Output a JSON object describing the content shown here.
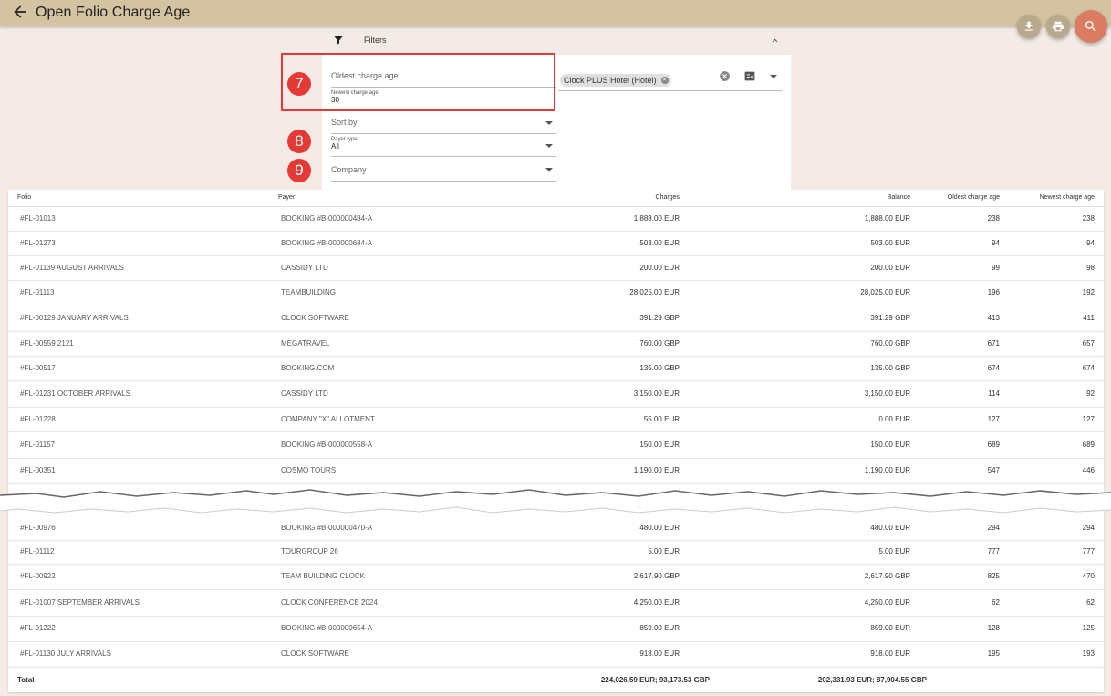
{
  "header": {
    "title": "Open Folio Charge Age"
  },
  "filters": {
    "label": "Filters",
    "oldest_charge_age": {
      "label": "Oldest charge age",
      "value": ""
    },
    "newest_charge_age": {
      "label": "Newest charge age",
      "value": "30"
    },
    "sort_by": {
      "label": "Sort by",
      "value": ""
    },
    "payer_type": {
      "label": "Payer type",
      "value": "All"
    },
    "company": {
      "label": "Company",
      "value": ""
    },
    "property_chip": "Clock PLUS Hotel (Hotel)"
  },
  "badges": [
    "7",
    "8",
    "9"
  ],
  "table": {
    "columns": [
      "Folio",
      "Payer",
      "Charges",
      "Balance",
      "Oldest charge age",
      "Newest charge age"
    ],
    "rows_top": [
      {
        "folio": "#FL-01013",
        "payer": "BOOKING #B-000000484-A",
        "charges": "1,888.00 EUR",
        "balance": "1,888.00 EUR",
        "oldest": "238",
        "newest": "238"
      },
      {
        "folio": "#FL-01273",
        "payer": "BOOKING #B-000000684-A",
        "charges": "503.00 EUR",
        "balance": "503.00 EUR",
        "oldest": "94",
        "newest": "94"
      },
      {
        "folio": "#FL-01139 AUGUST ARRIVALS",
        "payer": "CASSIDY LTD",
        "charges": "200.00 EUR",
        "balance": "200.00 EUR",
        "oldest": "99",
        "newest": "98"
      },
      {
        "folio": "#FL-01113",
        "payer": "TEAMBUILDING",
        "charges": "28,025.00 EUR",
        "balance": "28,025.00 EUR",
        "oldest": "196",
        "newest": "192"
      },
      {
        "folio": "#FL-00129 JANUARY ARRIVALS",
        "payer": "CLOCK SOFTWARE",
        "charges": "391.29 GBP",
        "balance": "391.29 GBP",
        "oldest": "413",
        "newest": "411"
      },
      {
        "folio": "#FL-00559 2121",
        "payer": "MEGATRAVEL",
        "charges": "760.00 GBP",
        "balance": "760.00 GBP",
        "oldest": "671",
        "newest": "657"
      },
      {
        "folio": "#FL-00517",
        "payer": "BOOKING.COM",
        "charges": "135.00 GBP",
        "balance": "135.00 GBP",
        "oldest": "674",
        "newest": "674"
      },
      {
        "folio": "#FL-01231 OCTOBER ARRIVALS",
        "payer": "CASSIDY LTD",
        "charges": "3,150.00 EUR",
        "balance": "3,150.00 EUR",
        "oldest": "114",
        "newest": "92"
      },
      {
        "folio": "#FL-01228",
        "payer": "COMPANY \"X\" ALLOTMENT",
        "charges": "55.00 EUR",
        "balance": "0.00 EUR",
        "oldest": "127",
        "newest": "127"
      },
      {
        "folio": "#FL-01157",
        "payer": "BOOKING #B-000000558-A",
        "charges": "150.00 EUR",
        "balance": "150.00 EUR",
        "oldest": "689",
        "newest": "689"
      },
      {
        "folio": "#FL-00351",
        "payer": "COSMO TOURS",
        "charges": "1,190.00 EUR",
        "balance": "1,190.00 EUR",
        "oldest": "547",
        "newest": "446"
      }
    ],
    "rows_bottom": [
      {
        "folio": "#FL-00976",
        "payer": "BOOKING #B-000000470-A",
        "charges": "480.00 EUR",
        "balance": "480.00 EUR",
        "oldest": "294",
        "newest": "294"
      },
      {
        "folio": "#FL-01112",
        "payer": "TOURGROUP 26",
        "charges": "5.00 EUR",
        "balance": "5.00 EUR",
        "oldest": "777",
        "newest": "777"
      },
      {
        "folio": "#FL-00922",
        "payer": "TEAM BUILDING CLOCK",
        "charges": "2,617.90 GBP",
        "balance": "2,617.90 GBP",
        "oldest": "825",
        "newest": "470"
      },
      {
        "folio": "#FL-01007 SEPTEMBER ARRIVALS",
        "payer": "CLOCK CONFERENCE 2024",
        "charges": "4,250.00 EUR",
        "balance": "4,250.00 EUR",
        "oldest": "62",
        "newest": "62"
      },
      {
        "folio": "#FL-01222",
        "payer": "BOOKING #B-000000654-A",
        "charges": "859.00 EUR",
        "balance": "859.00 EUR",
        "oldest": "128",
        "newest": "125"
      },
      {
        "folio": "#FL-01130 JULY ARRIVALS",
        "payer": "CLOCK SOFTWARE",
        "charges": "918.00 EUR",
        "balance": "918.00 EUR",
        "oldest": "195",
        "newest": "193"
      }
    ],
    "total": {
      "label": "Total",
      "charges": "224,026.59 EUR; 93,173.53 GBP",
      "balance": "202,331.93 EUR; 87,904.55 GBP"
    }
  },
  "colors": {
    "topbar": "#d3c3a0",
    "background": "#f5ebe6",
    "search_fab": "#d97c62",
    "highlight": "#e53935"
  },
  "icons": [
    "back-arrow-icon",
    "download-icon",
    "print-icon",
    "search-icon",
    "filter-icon",
    "chevron-up-icon",
    "clear-icon",
    "checklist-icon",
    "dropdown-arrow-icon"
  ]
}
